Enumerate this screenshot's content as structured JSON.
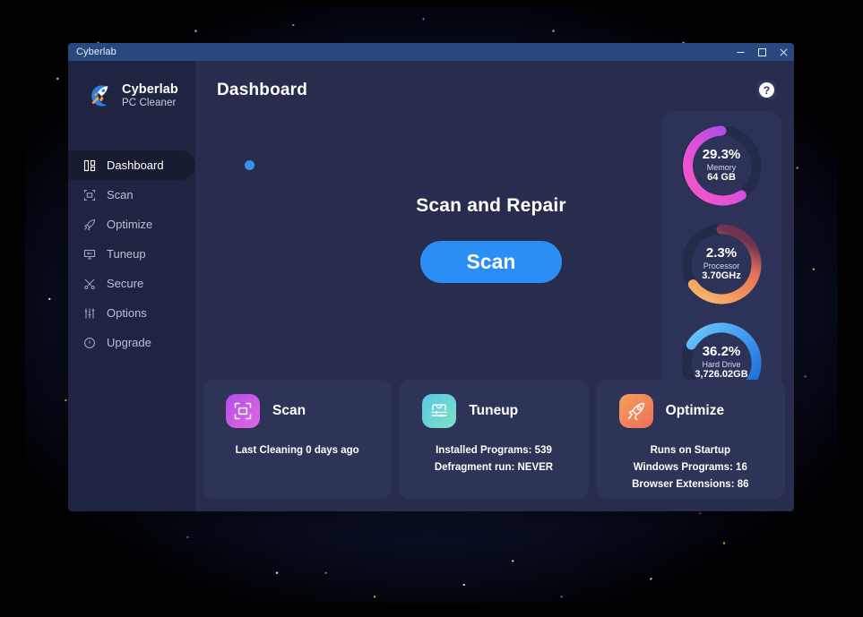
{
  "window": {
    "title": "Cyberlab",
    "controls": {
      "minimize": "minimize-button",
      "maximize": "maximize-button",
      "close": "close-button"
    }
  },
  "brand": {
    "name": "Cyberlab",
    "subtitle": "PC Cleaner",
    "logo_icon": "rocket-icon"
  },
  "sidebar": {
    "items": [
      {
        "label": "Dashboard",
        "icon": "grid-icon",
        "active": true
      },
      {
        "label": "Scan",
        "icon": "scan-icon",
        "active": false
      },
      {
        "label": "Optimize",
        "icon": "rocket-icon",
        "active": false
      },
      {
        "label": "Tuneup",
        "icon": "monitor-icon",
        "active": false
      },
      {
        "label": "Secure",
        "icon": "shield-icon",
        "active": false
      },
      {
        "label": "Options",
        "icon": "sliders-icon",
        "active": false
      },
      {
        "label": "Upgrade",
        "icon": "upgrade-icon",
        "active": false
      }
    ],
    "active_indicator_color": "#3b8ef0"
  },
  "header": {
    "page_title": "Dashboard",
    "help_label": "?",
    "help_icon": "help-icon"
  },
  "hero": {
    "title": "Scan and Repair",
    "button_label": "Scan",
    "button_color": "#2a8ef5"
  },
  "gauges": [
    {
      "percent": "29.3%",
      "value_number": 29.3,
      "name": "Memory",
      "value": "64 GB",
      "arc_start_color": "#9b4df0",
      "arc_end_color": "#f55ac0",
      "track_color": "#242a49",
      "arc_sweep_deg": 235,
      "arc_rotate_deg": 182
    },
    {
      "percent": "2.3%",
      "value_number": 2.3,
      "name": "Processor",
      "value": "3.70GHz",
      "arc_start_color": "#7a3550",
      "arc_end_color": "#f7a95c",
      "track_color": "#242a49",
      "arc_sweep_deg": 250,
      "arc_rotate_deg": 0
    },
    {
      "percent": "36.2%",
      "value_number": 36.2,
      "name": "Hard Drive",
      "value": "3,726.02GB",
      "arc_start_color": "#53b8f7",
      "arc_end_color": "#1f6fd8",
      "track_color": "#242a49",
      "arc_sweep_deg": 175,
      "arc_rotate_deg": -58
    }
  ],
  "cards": [
    {
      "title": "Scan",
      "icon": "scan-frame-icon",
      "lines": [
        "Last Cleaning 0 days ago"
      ]
    },
    {
      "title": "Tuneup",
      "icon": "monitor-slider-icon",
      "lines": [
        "Installed Programs: 539",
        "Defragment run: NEVER"
      ]
    },
    {
      "title": "Optimize",
      "icon": "rocket-icon",
      "lines": [
        "Runs on Startup",
        "Windows Programs: 16",
        "Browser Extensions: 86"
      ]
    }
  ],
  "theme": {
    "sidebar_bg": "#1f2440",
    "main_bg": "#282d4d",
    "card_bg": "#2e3458",
    "titlebar_bg": "#2a4880",
    "accent": "#2a8ef5"
  }
}
